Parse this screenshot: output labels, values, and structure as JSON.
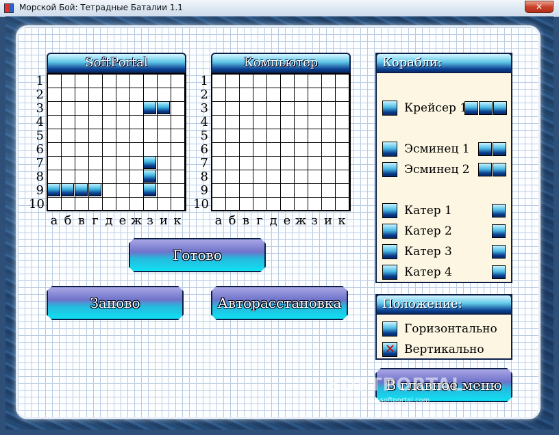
{
  "window": {
    "title": "Морской Бой: Тетрадные Баталии 1.1",
    "close": "✕"
  },
  "boards": {
    "player": {
      "title": "SoftPortal"
    },
    "computer": {
      "title": "Компьютер"
    },
    "row_labels": [
      "1",
      "2",
      "3",
      "4",
      "5",
      "6",
      "7",
      "8",
      "9",
      "10"
    ],
    "col_labels": [
      "а",
      "б",
      "в",
      "г",
      "д",
      "е",
      "ж",
      "з",
      "и",
      "к"
    ]
  },
  "ships_panel": {
    "title": "Корабли:",
    "items": [
      {
        "label": "Крейсер 1",
        "size": 3
      },
      {
        "label": "Эсминец 1",
        "size": 2
      },
      {
        "label": "Эсминец 2",
        "size": 2
      },
      {
        "label": "Катер 1",
        "size": 1
      },
      {
        "label": "Катер 2",
        "size": 1
      },
      {
        "label": "Катер 3",
        "size": 1
      },
      {
        "label": "Катер 4",
        "size": 1
      }
    ]
  },
  "position_panel": {
    "title": "Положение:",
    "horizontal": "Горизонтально",
    "vertical": "Вертикально",
    "vertical_mark": "✕"
  },
  "buttons": {
    "ready": "Готово",
    "reset": "Заново",
    "auto": "Авторасстановка",
    "main_menu": "В главное меню"
  },
  "watermark": {
    "text": "SOFTPORTAL",
    "sub": "www.softportal.com"
  },
  "colors": {
    "ship": "#0a3b8c",
    "accent": "#10e0f2",
    "panel": "#fcf6e2"
  }
}
